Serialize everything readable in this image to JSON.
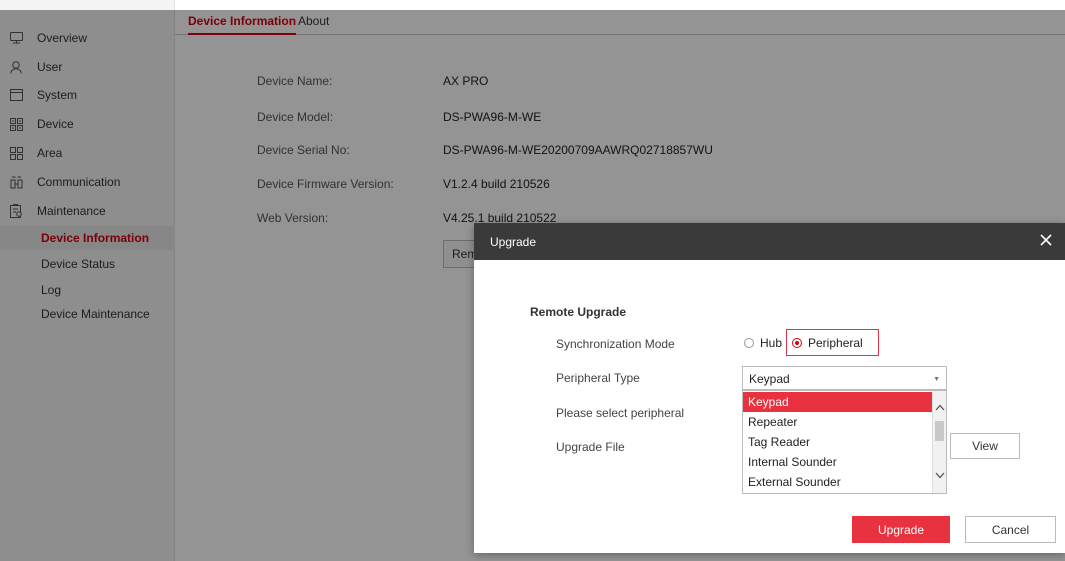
{
  "sidebar": {
    "items": [
      {
        "label": "Overview",
        "icon": "monitor-icon"
      },
      {
        "label": "User",
        "icon": "user-icon"
      },
      {
        "label": "System",
        "icon": "window-icon"
      },
      {
        "label": "Device",
        "icon": "grid-icon"
      },
      {
        "label": "Area",
        "icon": "area-icon"
      },
      {
        "label": "Communication",
        "icon": "communication-icon"
      },
      {
        "label": "Maintenance",
        "icon": "maintenance-icon"
      }
    ],
    "sub_items": [
      {
        "label": "Device Information",
        "active": true
      },
      {
        "label": "Device Status",
        "active": false
      },
      {
        "label": "Log",
        "active": false
      },
      {
        "label": "Device Maintenance",
        "active": false
      }
    ]
  },
  "tabs": [
    {
      "label": "Device Information",
      "active": true
    },
    {
      "label": "About",
      "active": false
    }
  ],
  "info": {
    "rows": [
      {
        "label": "Device Name:",
        "value": "AX PRO"
      },
      {
        "label": "Device Model:",
        "value": "DS-PWA96-M-WE"
      },
      {
        "label": "Device Serial No:",
        "value": "DS-PWA96-M-WE20200709AAWRQ02718857WU"
      },
      {
        "label": "Device Firmware Version:",
        "value": "V1.2.4 build 210526"
      },
      {
        "label": "Web Version:",
        "value": "V4.25.1 build 210522"
      }
    ],
    "remote_button_label": "Rem"
  },
  "dialog": {
    "title": "Upgrade",
    "close_icon": "close-icon",
    "section_title": "Remote Upgrade",
    "sync_mode_label": "Synchronization Mode",
    "sync_options": [
      {
        "label": "Hub",
        "checked": false
      },
      {
        "label": "Peripheral",
        "checked": true
      }
    ],
    "peripheral_type_label": "Peripheral Type",
    "peripheral_type_value": "Keypad",
    "select_peripheral_label": "Please select peripheral",
    "upgrade_file_label": "Upgrade File",
    "dropdown_options": [
      {
        "label": "Keypad",
        "selected": true
      },
      {
        "label": "Repeater",
        "selected": false
      },
      {
        "label": "Tag Reader",
        "selected": false
      },
      {
        "label": "Internal Sounder",
        "selected": false
      },
      {
        "label": "External Sounder",
        "selected": false
      }
    ],
    "view_label": "View",
    "upgrade_label": "Upgrade",
    "cancel_label": "Cancel"
  },
  "colors": {
    "accent": "#d7000f",
    "button_red": "#e8323f",
    "header_dark": "#3a3a3a"
  }
}
